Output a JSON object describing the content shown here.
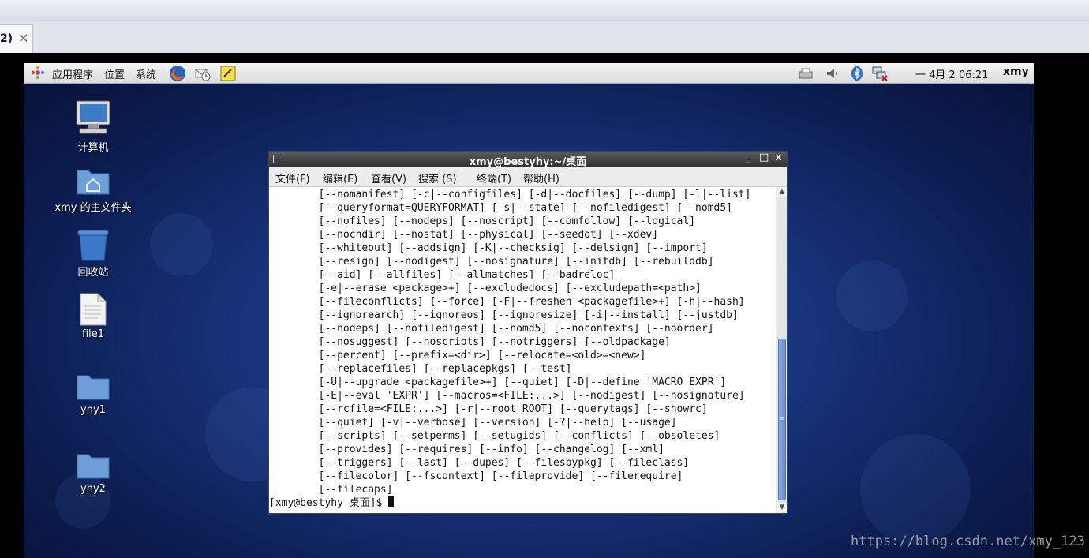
{
  "host": {
    "tab_title": "2)",
    "tab_close": "✕"
  },
  "panel": {
    "menu_applications": "应用程序",
    "menu_places": "位置",
    "menu_system": "系统",
    "clock": "一 4月  2 06:21",
    "user": "xmy"
  },
  "desktop": {
    "icons": [
      {
        "label": "计算机",
        "icon": "computer-icon"
      },
      {
        "label": "xmy 的主文件夹",
        "icon": "home-folder-icon"
      },
      {
        "label": "回收站",
        "icon": "trash-icon"
      },
      {
        "label": "file1",
        "icon": "file-icon"
      },
      {
        "label": "yhy1",
        "icon": "folder-icon"
      },
      {
        "label": "yhy2",
        "icon": "folder-icon"
      }
    ]
  },
  "terminal": {
    "title": "xmy@bestyhy:~/桌面",
    "menu": [
      "文件(F)",
      "编辑(E)",
      "查看(V)",
      "搜索 (S)",
      "终端(T)",
      "帮助(H)"
    ],
    "lines": [
      "        [--nomanifest] [-c|--configfiles] [-d|--docfiles] [--dump] [-l|--list]",
      "        [--queryformat=QUERYFORMAT] [-s|--state] [--nofiledigest] [--nomd5]",
      "        [--nofiles] [--nodeps] [--noscript] [--comfollow] [--logical]",
      "        [--nochdir] [--nostat] [--physical] [--seedot] [--xdev]",
      "        [--whiteout] [--addsign] [-K|--checksig] [--delsign] [--import]",
      "        [--resign] [--nodigest] [--nosignature] [--initdb] [--rebuilddb]",
      "        [--aid] [--allfiles] [--allmatches] [--badreloc]",
      "        [-e|--erase <package>+] [--excludedocs] [--excludepath=<path>]",
      "        [--fileconflicts] [--force] [-F|--freshen <packagefile>+] [-h|--hash]",
      "        [--ignorearch] [--ignoreos] [--ignoresize] [-i|--install] [--justdb]",
      "        [--nodeps] [--nofiledigest] [--nomd5] [--nocontexts] [--noorder]",
      "        [--nosuggest] [--noscripts] [--notriggers] [--oldpackage]",
      "        [--percent] [--prefix=<dir>] [--relocate=<old>=<new>]",
      "        [--replacefiles] [--replacepkgs] [--test]",
      "        [-U|--upgrade <packagefile>+] [--quiet] [-D|--define 'MACRO EXPR']",
      "        [-E|--eval 'EXPR'] [--macros=<FILE:...>] [--nodigest] [--nosignature]",
      "        [--rcfile=<FILE:...>] [-r|--root ROOT] [--querytags] [--showrc]",
      "        [--quiet] [-v|--verbose] [--version] [-?|--help] [--usage]",
      "        [--scripts] [--setperms] [--setugids] [--conflicts] [--obsoletes]",
      "        [--provides] [--requires] [--info] [--changelog] [--xml]",
      "        [--triggers] [--last] [--dupes] [--filesbypkg] [--fileclass]",
      "        [--filecolor] [--fscontext] [--fileprovide] [--filerequire]",
      "        [--filecaps]",
      "[xmy@bestyhy 桌面]$ "
    ]
  },
  "watermark": "https://blog.csdn.net/xmy_123"
}
